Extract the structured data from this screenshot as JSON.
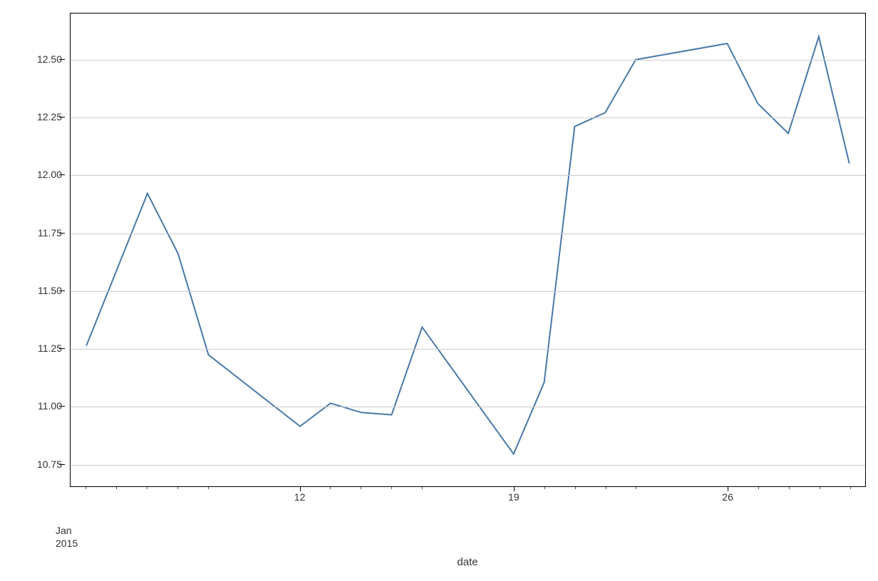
{
  "chart_data": {
    "type": "line",
    "xlabel": "date",
    "ylabel": "",
    "title": "",
    "x_offset_label": "Jan\n2015",
    "y_ticks": [
      10.75,
      11.0,
      11.25,
      11.5,
      11.75,
      12.0,
      12.25,
      12.5
    ],
    "y_tick_labels": [
      "10.75",
      "11.00",
      "11.25",
      "11.50",
      "11.75",
      "12.00",
      "12.25",
      "12.50"
    ],
    "x_major_ticks": [
      12,
      19,
      26
    ],
    "x_major_labels": [
      "12",
      "19",
      "26"
    ],
    "x_minor_ticks": [
      5,
      6,
      7,
      8,
      9,
      13,
      14,
      15,
      16,
      20,
      21,
      22,
      23,
      27,
      28,
      29,
      30
    ],
    "x_range": [
      5,
      30
    ],
    "y_range": [
      10.65,
      12.7
    ],
    "x": [
      5,
      6,
      7,
      8,
      9,
      12,
      13,
      14,
      15,
      16,
      19,
      20,
      21,
      22,
      23,
      26,
      27,
      28,
      29,
      30
    ],
    "y": [
      11.26,
      11.59,
      11.92,
      11.66,
      11.22,
      10.91,
      11.01,
      10.97,
      10.96,
      11.34,
      10.79,
      11.1,
      12.21,
      12.27,
      12.5,
      12.57,
      12.31,
      12.18,
      12.6,
      12.05
    ]
  }
}
